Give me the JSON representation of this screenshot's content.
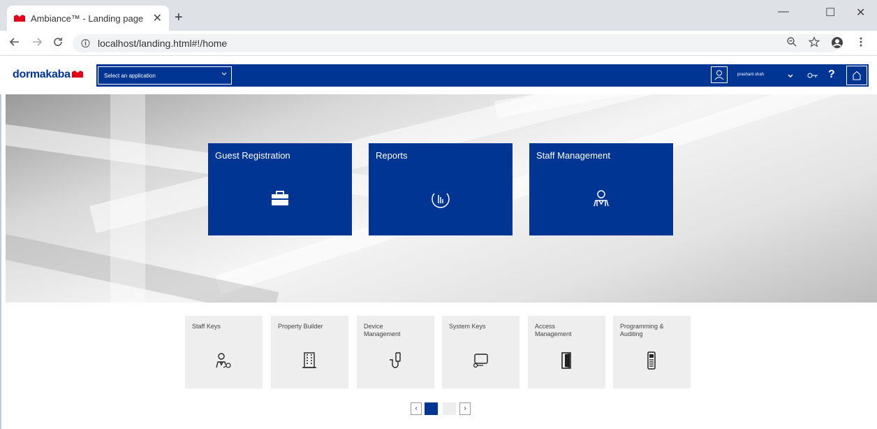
{
  "browser": {
    "tab_title": "Ambiance™ - Landing page",
    "tab_close": "✕",
    "new_tab": "+",
    "url": "localhost/landing.html#!/home",
    "win_min": "—",
    "win_max": "☐",
    "win_close": "✕"
  },
  "app": {
    "logo": "dormakaba",
    "select_placeholder": "Select an application",
    "user_name": "prashant shah",
    "help": "?",
    "colors": {
      "brand_blue": "#003594",
      "brand_red": "#e2001a"
    }
  },
  "main_tiles": [
    {
      "label": "Guest Registration",
      "icon": "toolbox-icon"
    },
    {
      "label": "Reports",
      "icon": "report-chart-icon"
    },
    {
      "label": "Staff Management",
      "icon": "staff-icon"
    }
  ],
  "small_tiles": [
    {
      "label": "Staff Keys",
      "icon": "staff-key-icon"
    },
    {
      "label": "Property Builder",
      "icon": "building-icon"
    },
    {
      "label": "Device\nManagement",
      "icon": "device-icon"
    },
    {
      "label": "System Keys",
      "icon": "system-key-icon"
    },
    {
      "label": "Access\nManagement",
      "icon": "door-icon"
    },
    {
      "label": "Programming &\nAuditing",
      "icon": "programmer-icon"
    }
  ],
  "pager": {
    "prev": "‹",
    "next": "›",
    "pages": 2,
    "current": 1
  }
}
